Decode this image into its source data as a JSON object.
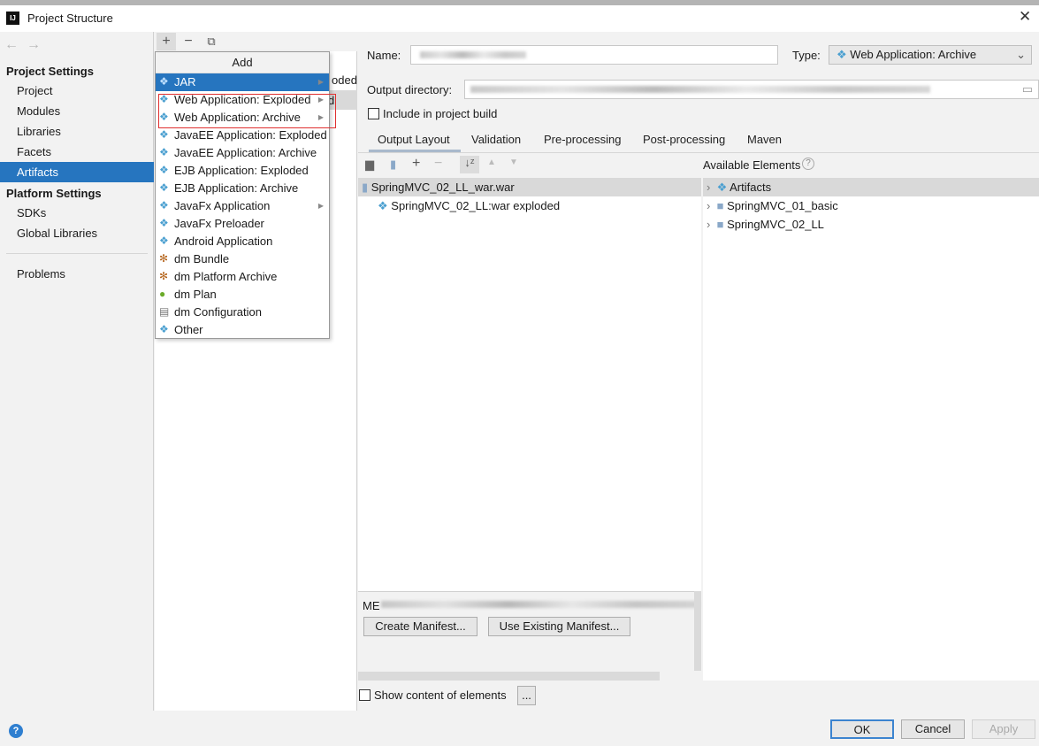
{
  "window": {
    "title": "Project Structure",
    "close": "✕",
    "icon_text": "IJ"
  },
  "sidebar": {
    "project_settings": "Project Settings",
    "items": [
      {
        "label": "Project"
      },
      {
        "label": "Modules"
      },
      {
        "label": "Libraries"
      },
      {
        "label": "Facets"
      },
      {
        "label": "Artifacts",
        "selected": true
      }
    ],
    "platform_settings": "Platform Settings",
    "platform_items": [
      {
        "label": "SDKs"
      },
      {
        "label": "Global Libraries"
      }
    ],
    "problems": "Problems"
  },
  "middle": {
    "partial_row1": "oded",
    "partial_row2": "d"
  },
  "add_menu": {
    "title": "Add",
    "items": [
      {
        "label": "JAR",
        "submenu": true,
        "selected": true
      },
      {
        "label": "Web Application: Exploded",
        "submenu": true
      },
      {
        "label": "Web Application: Archive",
        "submenu": true
      },
      {
        "label": "JavaEE Application: Exploded"
      },
      {
        "label": "JavaEE Application: Archive"
      },
      {
        "label": "EJB Application: Exploded"
      },
      {
        "label": "EJB Application: Archive"
      },
      {
        "label": "JavaFx Application",
        "submenu": true
      },
      {
        "label": "JavaFx Preloader"
      },
      {
        "label": "Android Application"
      },
      {
        "label": "dm Bundle"
      },
      {
        "label": "dm Platform Archive"
      },
      {
        "label": "dm Plan"
      },
      {
        "label": "dm Configuration"
      },
      {
        "label": "Other"
      }
    ]
  },
  "main": {
    "name_label": "Name:",
    "type_label": "Type:",
    "type_value": "Web Application: Archive",
    "output_dir_label": "Output directory:",
    "include_build": "Include in project build",
    "tabs": [
      "Output Layout",
      "Validation",
      "Pre-processing",
      "Post-processing",
      "Maven"
    ],
    "active_tab": "Output Layout",
    "available_elements": "Available Elements",
    "tree": [
      {
        "label": "SpringMVC_02_LL_war.war"
      },
      {
        "label": "SpringMVC_02_LL:war exploded"
      }
    ],
    "available": [
      {
        "label": "Artifacts"
      },
      {
        "label": "SpringMVC_01_basic"
      },
      {
        "label": "SpringMVC_02_LL"
      }
    ],
    "manifest_prefix": "ME",
    "create_manifest": "Create Manifest...",
    "use_existing_manifest": "Use Existing Manifest...",
    "show_content": "Show content of elements",
    "ellipsis": "..."
  },
  "footer": {
    "ok": "OK",
    "cancel": "Cancel",
    "apply": "Apply",
    "help": "?"
  },
  "colors": {
    "selection": "#2675bf",
    "highlight_box": "#e03030"
  }
}
